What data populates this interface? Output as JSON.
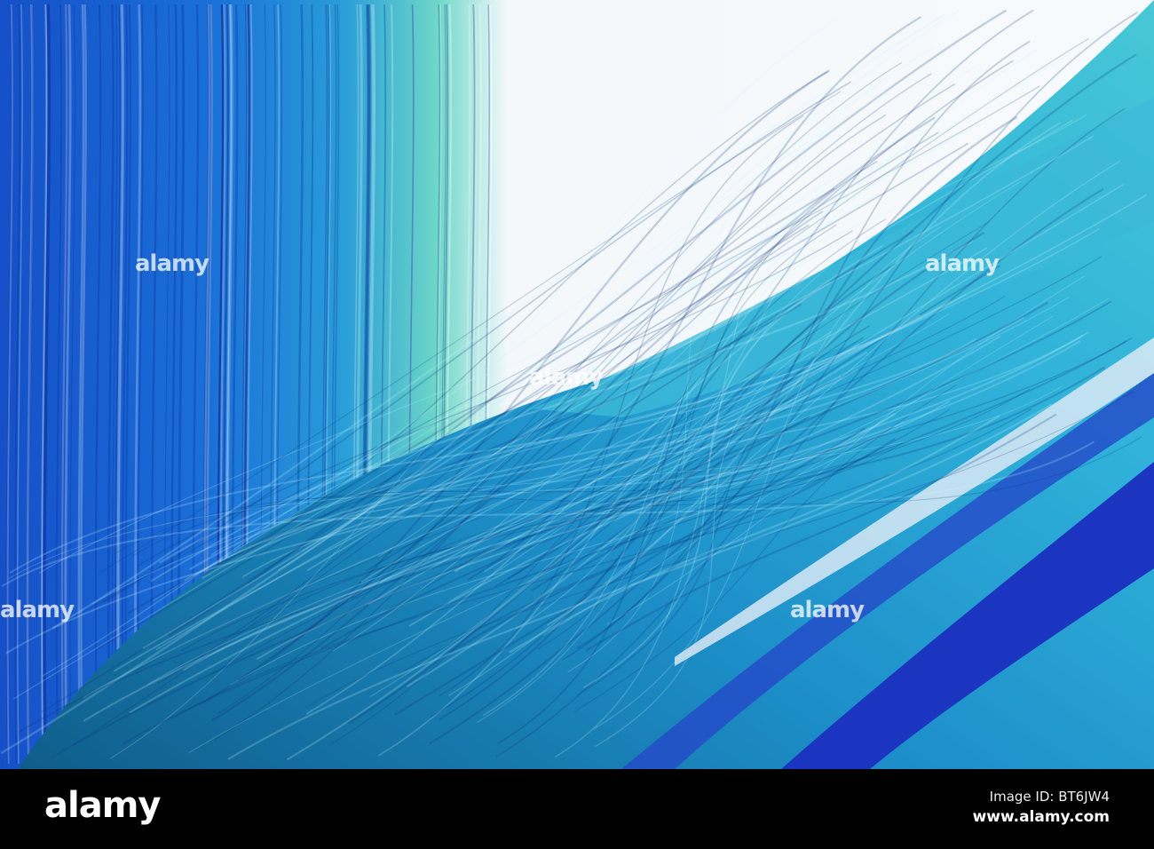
{
  "photo": {
    "subject": "blue glass sculpture strands",
    "colors": {
      "deep_blue": "#1a3fc4",
      "cyan": "#2aa7d8",
      "aqua": "#5fd6c8",
      "sky": "#f4f8fb"
    }
  },
  "watermark": {
    "text": "alamy"
  },
  "footer": {
    "logo": "alamy",
    "image_id": "Image ID: BT6JW4",
    "url": "www.alamy.com"
  }
}
